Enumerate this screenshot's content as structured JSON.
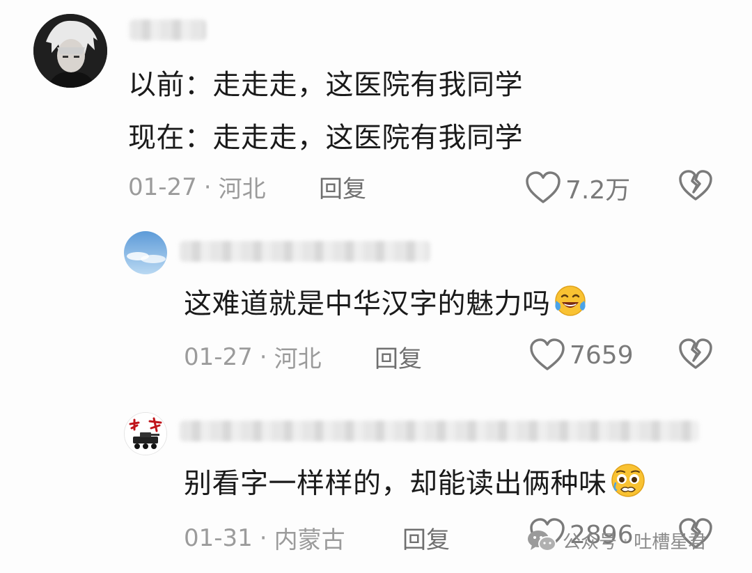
{
  "comments": [
    {
      "lines": [
        "以前：走走走，这医院有我同学",
        "现在：走走走，这医院有我同学"
      ],
      "date": "01-27",
      "location": "河北",
      "reply_label": "回复",
      "likes": "7.2万"
    },
    {
      "lines": [
        "这难道就是中华汉字的魅力吗"
      ],
      "emoji": "laughing-tears-emoji",
      "date": "01-27",
      "location": "河北",
      "reply_label": "回复",
      "likes": "7659"
    },
    {
      "lines": [
        "别看字一样样的，却能读出俩种味"
      ],
      "emoji": "pleading-face-emoji",
      "date": "01-31",
      "location": "内蒙古",
      "reply_label": "回复",
      "likes": "2896"
    }
  ],
  "separator": "·",
  "watermark": {
    "icon": "wechat-icon",
    "label": "公众号",
    "separator": "·",
    "account": "吐槽星君"
  },
  "colors": {
    "text": "#1a1a1a",
    "meta": "#9b9b9b",
    "icon": "#7a7a7a"
  }
}
